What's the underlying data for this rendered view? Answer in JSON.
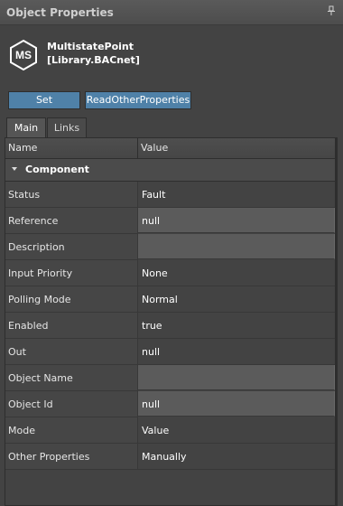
{
  "panel": {
    "title": "Object Properties"
  },
  "object": {
    "icon_text": "MS",
    "name_line1": "MultistatePoint",
    "name_line2": "[Library.BACnet]"
  },
  "buttons": {
    "set": "Set",
    "read_other": "ReadOtherProperties"
  },
  "tabs": [
    {
      "label": "Main",
      "active": true
    },
    {
      "label": "Links",
      "active": false
    }
  ],
  "grid": {
    "columns": {
      "name": "Name",
      "value": "Value"
    },
    "section": "Component",
    "rows": [
      {
        "name": "Status",
        "value": "Fault",
        "editable": false
      },
      {
        "name": "Reference",
        "value": "null",
        "editable": true
      },
      {
        "name": "Description",
        "value": "",
        "editable": true
      },
      {
        "name": "Input Priority",
        "value": "None",
        "editable": false
      },
      {
        "name": "Polling Mode",
        "value": "Normal",
        "editable": false
      },
      {
        "name": "Enabled",
        "value": "true",
        "editable": false
      },
      {
        "name": "Out",
        "value": "null",
        "editable": false
      },
      {
        "name": "Object Name",
        "value": "",
        "editable": true
      },
      {
        "name": "Object Id",
        "value": "null",
        "editable": true
      },
      {
        "name": "Mode",
        "value": "Value",
        "editable": false
      },
      {
        "name": "Other Properties",
        "value": "Manually",
        "editable": false
      }
    ]
  },
  "colors": {
    "button": "#4f81a8",
    "background": "#434343",
    "editable_cell": "#5b5b5b"
  }
}
